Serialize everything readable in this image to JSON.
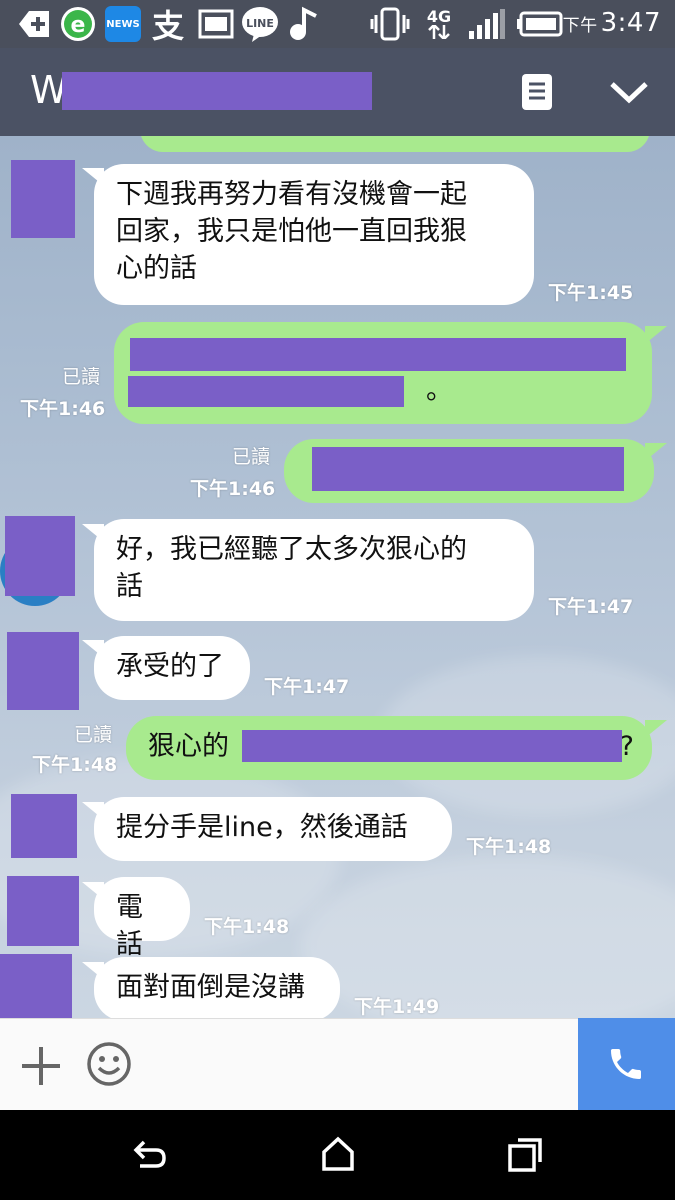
{
  "status_bar": {
    "time_prefix": "下午",
    "time": "3:47",
    "network": "4G",
    "icons": [
      "add-icon",
      "e-app-icon",
      "news-icon",
      "alipay-icon",
      "image-icon",
      "line-icon",
      "music-icon",
      "vibrate-icon",
      "network-icon",
      "signal-icon",
      "battery-icon"
    ],
    "news_label": "NEWS",
    "line_label": "LINE",
    "alipay_glyph": "支"
  },
  "header": {
    "title_initial": "W",
    "menu_icon": "list-icon",
    "collapse_icon": "chevron-down-icon"
  },
  "messages": [
    {
      "side": "in",
      "lines": [
        "下週我再努力看有沒機會一起",
        "回家，我只是怕他一直回我狠",
        "心的話"
      ],
      "time": "下午1:45"
    },
    {
      "side": "out",
      "visible_text": "。",
      "read": "已讀",
      "time": "下午1:46"
    },
    {
      "side": "out",
      "visible_text": "",
      "read": "已讀",
      "time": "下午1:46"
    },
    {
      "side": "in",
      "lines": [
        "好，我已經聽了太多次狠心的",
        "話"
      ],
      "time": "下午1:47"
    },
    {
      "side": "in",
      "lines": [
        "承受的了"
      ],
      "time": "下午1:47"
    },
    {
      "side": "out",
      "visible_text_start": "狠心的",
      "visible_text_end": "?",
      "read": "已讀",
      "time": "下午1:48"
    },
    {
      "side": "in",
      "lines": [
        "提分手是line，然後通話"
      ],
      "time": "下午1:48"
    },
    {
      "side": "in",
      "lines": [
        "電話"
      ],
      "time": "下午1:48"
    },
    {
      "side": "in",
      "lines": [
        "面對面倒是沒講"
      ],
      "time": "下午1:49"
    }
  ],
  "input_bar": {
    "add_icon": "plus-icon",
    "emoji_icon": "smiley-icon",
    "call_icon": "phone-icon"
  },
  "nav_bar": {
    "icons": [
      "back-icon",
      "home-icon",
      "recents-icon"
    ]
  },
  "colors": {
    "header": "#4b5264",
    "status_bar": "#4a4f5c",
    "outgoing_bubble": "#a8ea8e",
    "incoming_bubble": "#ffffff",
    "call_button": "#4f8ee8",
    "redaction": "#7a5fc7"
  }
}
